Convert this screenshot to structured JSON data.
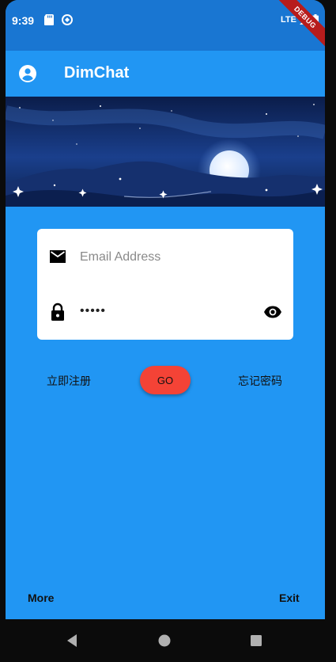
{
  "status_bar": {
    "time": "9:39",
    "network": "LTE",
    "icons": [
      "sd-card-icon",
      "sync-icon",
      "signal-icon",
      "battery-icon"
    ]
  },
  "debug_banner": "DEBUG",
  "app_bar": {
    "title": "DimChat",
    "leading_icon": "account-circle-icon"
  },
  "login_form": {
    "email": {
      "placeholder": "Email Address",
      "value": "",
      "icon": "mail-icon"
    },
    "password": {
      "value": "•••••",
      "icon": "lock-icon",
      "toggle_icon": "eye-icon"
    }
  },
  "actions": {
    "register_label": "立即注册",
    "go_label": "GO",
    "forgot_label": "忘记密码"
  },
  "bottom": {
    "more_label": "More",
    "exit_label": "Exit"
  },
  "nav_bar": {
    "buttons": [
      "back-icon",
      "home-icon",
      "recents-icon"
    ]
  },
  "colors": {
    "primary": "#2196F3",
    "primary_dark": "#1976D2",
    "go_button": "#F44336",
    "card": "#FFFFFF"
  }
}
